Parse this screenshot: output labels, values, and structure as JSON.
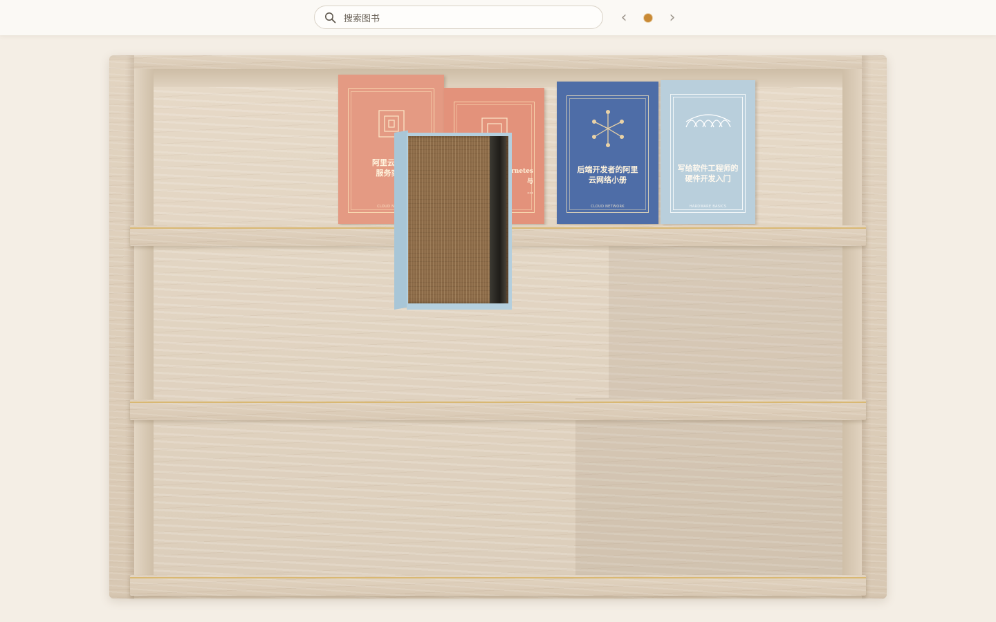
{
  "search": {
    "placeholder": "搜索图书"
  },
  "pagination": {
    "prev_label": "‹",
    "next_label": "›",
    "current_page": 1,
    "total_pages": 1
  },
  "colors": {
    "accent": "#c98a35",
    "background": "#f4eee5"
  },
  "books": [
    {
      "title": "阿里云云原生服务实践",
      "title_lines": [
        "阿里云云原",
        "服务实践"
      ],
      "subtitle": "CLOUD NATIVE",
      "color": "#e49a83",
      "icon": "frame-glyph-icon"
    },
    {
      "title": "Kubernetes 与 ...",
      "title_lines": [
        "Kubernetes 与",
        "…"
      ],
      "subtitle": "",
      "color": "#e3927b",
      "icon": "frame-glyph-icon"
    },
    {
      "title": "后端开发者的阿里云网络小册",
      "title_lines": [
        "后端开发者的阿里",
        "云网络小册"
      ],
      "subtitle": "CLOUD NETWORK",
      "color": "#4e6da7",
      "icon": "network-star-icon"
    },
    {
      "title": "写给软件工程师的硬件开发入门",
      "title_lines": [
        "写给软件工程师的",
        "硬件开发入门"
      ],
      "subtitle": "HARDWARE BASICS",
      "color": "#b9cfdc",
      "icon": "arches-icon"
    }
  ],
  "floating_book": {
    "state": "being dragged",
    "color": "#b4cfde"
  }
}
